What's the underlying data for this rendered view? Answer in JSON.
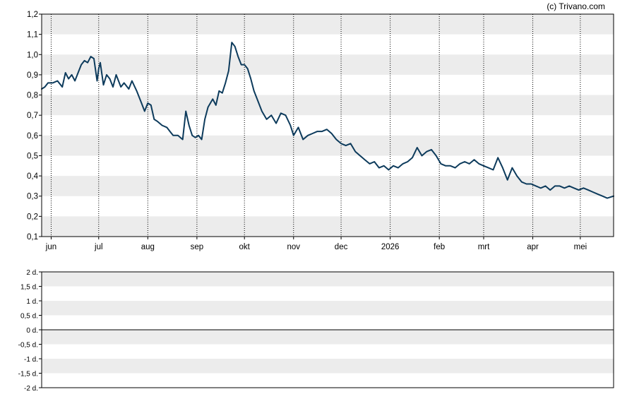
{
  "credit": "(c) Trivano.com",
  "colors": {
    "line": "#0d3b5c",
    "band": "#ececec",
    "grid": "#000000"
  },
  "chart_data": [
    {
      "type": "line",
      "ylim": [
        0.1,
        1.2
      ],
      "y_ticks": [
        "0,1",
        "0,2",
        "0,3",
        "0,4",
        "0,5",
        "0,6",
        "0,7",
        "0,8",
        "0,9",
        "1,0",
        "1,1",
        "1,2"
      ],
      "y_tick_values": [
        0.1,
        0.2,
        0.3,
        0.4,
        0.5,
        0.6,
        0.7,
        0.8,
        0.9,
        1.0,
        1.1,
        1.2
      ],
      "x_ticks": [
        "jun",
        "jul",
        "aug",
        "sep",
        "okt",
        "nov",
        "dec",
        "2026",
        "feb",
        "mrt",
        "apr",
        "mei"
      ],
      "x_tick_dates": [
        "2025-06-01",
        "2025-07-01",
        "2025-08-01",
        "2025-09-01",
        "2025-10-01",
        "2025-11-01",
        "2025-12-01",
        "2026-01-01",
        "2026-02-01",
        "2026-03-01",
        "2026-04-01",
        "2026-05-01"
      ],
      "x_range": [
        "2025-05-26",
        "2026-05-22"
      ],
      "grid": "vertical dotted lines and alternating horizontal bands",
      "series": [
        {
          "x": [
            "2025-05-26",
            "2025-05-28",
            "2025-05-30",
            "2025-06-02",
            "2025-06-05",
            "2025-06-08",
            "2025-06-10",
            "2025-06-12",
            "2025-06-14",
            "2025-06-16",
            "2025-06-18",
            "2025-06-20",
            "2025-06-22",
            "2025-06-24",
            "2025-06-26",
            "2025-06-28",
            "2025-06-30",
            "2025-07-01",
            "2025-07-02",
            "2025-07-04",
            "2025-07-06",
            "2025-07-08",
            "2025-07-10",
            "2025-07-12",
            "2025-07-15",
            "2025-07-17",
            "2025-07-20",
            "2025-07-22",
            "2025-07-25",
            "2025-07-28",
            "2025-07-30",
            "2025-08-01",
            "2025-08-03",
            "2025-08-05",
            "2025-08-07",
            "2025-08-10",
            "2025-08-13",
            "2025-08-15",
            "2025-08-17",
            "2025-08-20",
            "2025-08-23",
            "2025-08-25",
            "2025-08-27",
            "2025-08-29",
            "2025-08-31",
            "2025-09-02",
            "2025-09-04",
            "2025-09-06",
            "2025-09-08",
            "2025-09-11",
            "2025-09-13",
            "2025-09-15",
            "2025-09-17",
            "2025-09-19",
            "2025-09-21",
            "2025-09-23",
            "2025-09-25",
            "2025-09-27",
            "2025-09-29",
            "2025-10-01",
            "2025-10-03",
            "2025-10-05",
            "2025-10-07",
            "2025-10-09",
            "2025-10-12",
            "2025-10-15",
            "2025-10-18",
            "2025-10-21",
            "2025-10-24",
            "2025-10-27",
            "2025-10-30",
            "2025-11-01",
            "2025-11-04",
            "2025-11-07",
            "2025-11-10",
            "2025-11-13",
            "2025-11-16",
            "2025-11-19",
            "2025-11-22",
            "2025-11-25",
            "2025-11-28",
            "2025-12-01",
            "2025-12-04",
            "2025-12-07",
            "2025-12-10",
            "2025-12-13",
            "2025-12-16",
            "2025-12-19",
            "2025-12-22",
            "2025-12-25",
            "2025-12-28",
            "2025-12-31",
            "2026-01-03",
            "2026-01-06",
            "2026-01-09",
            "2026-01-12",
            "2026-01-15",
            "2026-01-18",
            "2026-01-21",
            "2026-01-24",
            "2026-01-27",
            "2026-01-30",
            "2026-02-02",
            "2026-02-05",
            "2026-02-08",
            "2026-02-11",
            "2026-02-14",
            "2026-02-17",
            "2026-02-20",
            "2026-02-23",
            "2026-02-26",
            "2026-03-01",
            "2026-03-04",
            "2026-03-07",
            "2026-03-10",
            "2026-03-13",
            "2026-03-16",
            "2026-03-19",
            "2026-03-22",
            "2026-03-25",
            "2026-03-28",
            "2026-03-31",
            "2026-04-03",
            "2026-04-06",
            "2026-04-09",
            "2026-04-12",
            "2026-04-15",
            "2026-04-18",
            "2026-04-21",
            "2026-04-24",
            "2026-04-27",
            "2026-04-30",
            "2026-05-03",
            "2026-05-06",
            "2026-05-09",
            "2026-05-12",
            "2026-05-15",
            "2026-05-18",
            "2026-05-22"
          ],
          "values": [
            0.83,
            0.84,
            0.86,
            0.86,
            0.87,
            0.84,
            0.91,
            0.88,
            0.9,
            0.87,
            0.91,
            0.95,
            0.97,
            0.96,
            0.99,
            0.98,
            0.87,
            0.93,
            0.96,
            0.85,
            0.9,
            0.88,
            0.84,
            0.9,
            0.84,
            0.86,
            0.83,
            0.87,
            0.82,
            0.76,
            0.72,
            0.76,
            0.75,
            0.68,
            0.67,
            0.65,
            0.64,
            0.62,
            0.6,
            0.6,
            0.58,
            0.72,
            0.65,
            0.6,
            0.59,
            0.6,
            0.58,
            0.68,
            0.74,
            0.78,
            0.75,
            0.82,
            0.81,
            0.86,
            0.92,
            1.06,
            1.04,
            0.99,
            0.95,
            0.95,
            0.93,
            0.88,
            0.82,
            0.78,
            0.72,
            0.68,
            0.7,
            0.66,
            0.71,
            0.7,
            0.65,
            0.6,
            0.64,
            0.58,
            0.6,
            0.61,
            0.62,
            0.62,
            0.63,
            0.61,
            0.58,
            0.56,
            0.55,
            0.56,
            0.52,
            0.5,
            0.48,
            0.46,
            0.47,
            0.44,
            0.45,
            0.43,
            0.45,
            0.44,
            0.46,
            0.47,
            0.49,
            0.54,
            0.5,
            0.52,
            0.53,
            0.5,
            0.46,
            0.45,
            0.45,
            0.44,
            0.46,
            0.47,
            0.46,
            0.48,
            0.46,
            0.45,
            0.44,
            0.43,
            0.49,
            0.44,
            0.38,
            0.44,
            0.4,
            0.37,
            0.36,
            0.36,
            0.35,
            0.34,
            0.35,
            0.33,
            0.35,
            0.35,
            0.34,
            0.35,
            0.34,
            0.33,
            0.34,
            0.33,
            0.32,
            0.31,
            0.3,
            0.29,
            0.3
          ]
        }
      ]
    },
    {
      "type": "bar",
      "ylim": [
        -2,
        2
      ],
      "y_ticks": [
        "2 d.",
        "1,5 d.",
        "1 d.",
        "0,5 d.",
        "0 d.",
        "-0,5 d.",
        "-1 d.",
        "-1,5 d.",
        "-2 d."
      ],
      "y_tick_values": [
        2,
        1.5,
        1,
        0.5,
        0,
        -0.5,
        -1,
        -1.5,
        -2
      ],
      "grid": "alternating horizontal bands with baseline at 0",
      "series": []
    }
  ]
}
